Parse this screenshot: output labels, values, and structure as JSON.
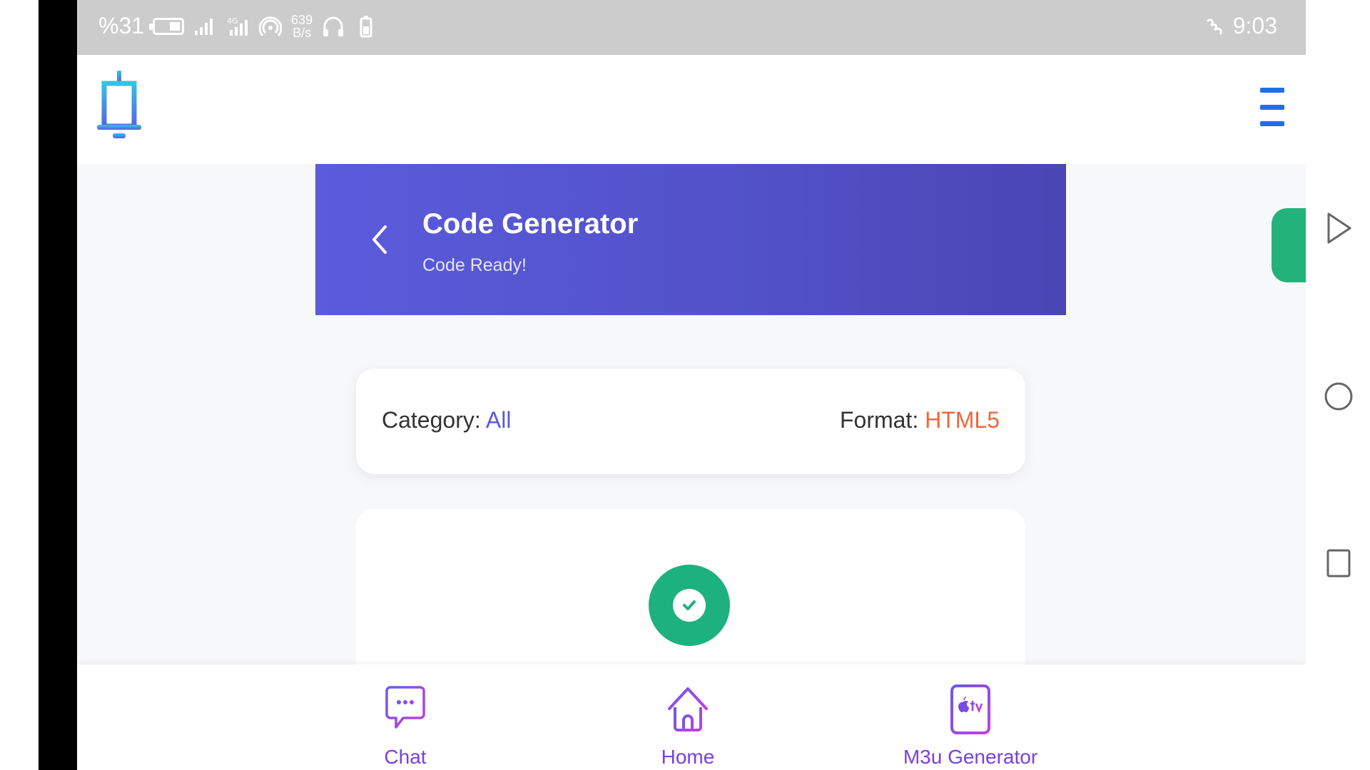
{
  "status_bar": {
    "battery_percent": "%31",
    "net_speed_value": "639",
    "net_speed_unit": "B/s",
    "time": "9:03"
  },
  "banner": {
    "title": "Code Generator",
    "subtitle": "Code Ready!"
  },
  "info": {
    "category_label": "Category: ",
    "category_value": "All",
    "format_label": "Format: ",
    "format_value": "HTML5"
  },
  "bottom_nav": {
    "items": [
      {
        "label": "Chat",
        "icon": "chat-icon"
      },
      {
        "label": "Home",
        "icon": "home-icon"
      },
      {
        "label": "M3u Generator",
        "icon": "apple-tv-icon"
      }
    ]
  },
  "colors": {
    "banner_start": "#5b5bdc",
    "banner_end": "#4a46b4",
    "category_value": "#5a59d6",
    "format_value": "#f0673a",
    "success": "#1db17f",
    "nav_label": "#7a3fe0",
    "menu": "#1e6ef0"
  }
}
